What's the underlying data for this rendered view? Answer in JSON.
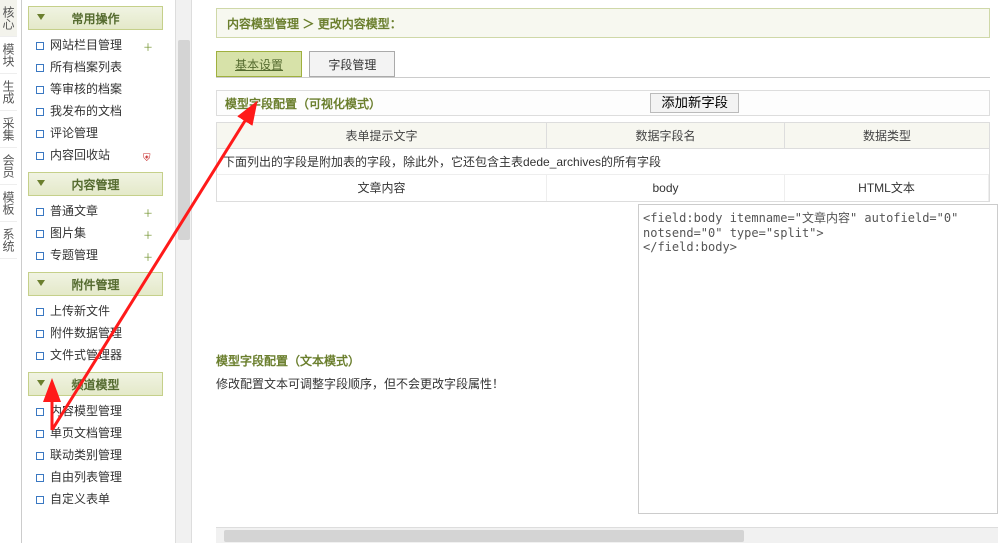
{
  "vnav": {
    "items": [
      "核心",
      "模块",
      "生成",
      "采集",
      "会员",
      "模板",
      "系统"
    ]
  },
  "sidebar": {
    "groups": [
      {
        "title": "常用操作",
        "items": [
          {
            "label": "网站栏目管理",
            "icon": "plus",
            "icon_color": "green"
          },
          {
            "label": "所有档案列表",
            "icon": "",
            "icon_color": ""
          },
          {
            "label": "等审核的档案",
            "icon": "",
            "icon_color": ""
          },
          {
            "label": "我发布的文档",
            "icon": "",
            "icon_color": ""
          },
          {
            "label": "评论管理",
            "icon": "",
            "icon_color": ""
          },
          {
            "label": "内容回收站",
            "icon": "shield",
            "icon_color": "red"
          }
        ]
      },
      {
        "title": "内容管理",
        "items": [
          {
            "label": "普通文章",
            "icon": "plus",
            "icon_color": "green"
          },
          {
            "label": "图片集",
            "icon": "plus",
            "icon_color": "green"
          },
          {
            "label": "专题管理",
            "icon": "plus",
            "icon_color": "green"
          }
        ]
      },
      {
        "title": "附件管理",
        "items": [
          {
            "label": "上传新文件",
            "icon": "",
            "icon_color": ""
          },
          {
            "label": "附件数据管理",
            "icon": "",
            "icon_color": ""
          },
          {
            "label": "文件式管理器",
            "icon": "",
            "icon_color": ""
          }
        ]
      },
      {
        "title": "频道模型",
        "items": [
          {
            "label": "内容模型管理",
            "icon": "",
            "icon_color": ""
          },
          {
            "label": "单页文档管理",
            "icon": "",
            "icon_color": ""
          },
          {
            "label": "联动类别管理",
            "icon": "",
            "icon_color": ""
          },
          {
            "label": "自由列表管理",
            "icon": "",
            "icon_color": ""
          },
          {
            "label": "自定义表单",
            "icon": "",
            "icon_color": ""
          }
        ]
      }
    ]
  },
  "breadcrumb": {
    "a": "内容模型管理",
    "sep": "＞",
    "b": "更改内容模型："
  },
  "tabs": {
    "basic": "基本设置",
    "fields": "字段管理"
  },
  "visual_section": {
    "title": "模型字段配置（可视化模式）",
    "add_btn": "添加新字段"
  },
  "grid": {
    "headers": [
      "表单提示文字",
      "数据字段名",
      "数据类型"
    ],
    "note": "下面列出的字段是附加表的字段，除此外，它还包含主表dede_archives的所有字段",
    "row1": [
      "文章内容",
      "body",
      "HTML文本"
    ]
  },
  "code": "<field:body itemname=\"文章内容\" autofield=\"0\" notsend=\"0\" type=\"split\">\n</field:body>",
  "text_section": {
    "title": "模型字段配置（文本模式）",
    "desc": "修改配置文本可调整字段顺序，但不会更改字段属性！"
  },
  "colors": {
    "olive": "#6b7f2e",
    "arrow": "#ff1a1a"
  }
}
